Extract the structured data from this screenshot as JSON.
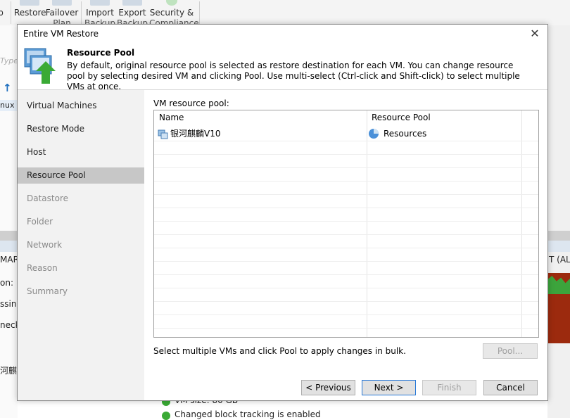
{
  "ribbon": {
    "items": [
      {
        "label": "p",
        "label2": ""
      },
      {
        "label": "Restore",
        "label2": ""
      },
      {
        "label": "Failover",
        "label2": "Plan"
      },
      {
        "label": "Import",
        "label2": "Backup"
      },
      {
        "label": "Export",
        "label2": "Backup"
      },
      {
        "label": "Security &",
        "label2": "Compliance"
      }
    ]
  },
  "background": {
    "type_hint": "Type",
    "row_label": "nux",
    "summary_left": "MARY",
    "summary_right": "T (ALL",
    "info_1": "on:",
    "info_2": "ssing",
    "info_3": "neck",
    "vm_name_cut": "河麒",
    "vm_size": "VM size: 80 GB",
    "cbt": "Changed block tracking is enabled"
  },
  "dialog": {
    "title": "Entire VM Restore",
    "close_glyph": "✕",
    "header": {
      "title": "Resource Pool",
      "description": "By default, original resource pool is selected as restore destination for each VM. You can change resource pool by selecting desired VM and clicking Pool. Use multi-select (Ctrl-click and Shift-click) to select multiple VMs at once."
    },
    "nav": [
      {
        "label": "Virtual Machines",
        "state": "done"
      },
      {
        "label": "Restore Mode",
        "state": "done"
      },
      {
        "label": "Host",
        "state": "done"
      },
      {
        "label": "Resource Pool",
        "state": "active"
      },
      {
        "label": "Datastore",
        "state": "disabled"
      },
      {
        "label": "Folder",
        "state": "disabled"
      },
      {
        "label": "Network",
        "state": "disabled"
      },
      {
        "label": "Reason",
        "state": "disabled"
      },
      {
        "label": "Summary",
        "state": "disabled"
      }
    ],
    "pool_label": "VM resource pool:",
    "grid": {
      "columns": [
        "Name",
        "Resource Pool"
      ],
      "rows": [
        {
          "name": "银河麒麟V10",
          "pool": "Resources",
          "name_icon": "vm-icon",
          "pool_icon": "resource-pool-icon"
        }
      ]
    },
    "bulk_text": "Select multiple VMs and click Pool to apply changes in bulk.",
    "buttons": {
      "pool": "Pool...",
      "previous": "< Previous",
      "next": "Next >",
      "finish": "Finish",
      "cancel": "Cancel"
    }
  },
  "colors": {
    "accent": "#2677d6",
    "nav_active": "#c7c7c7",
    "icon_green": "#3aaa35",
    "icon_blue": "#4a90d9"
  }
}
